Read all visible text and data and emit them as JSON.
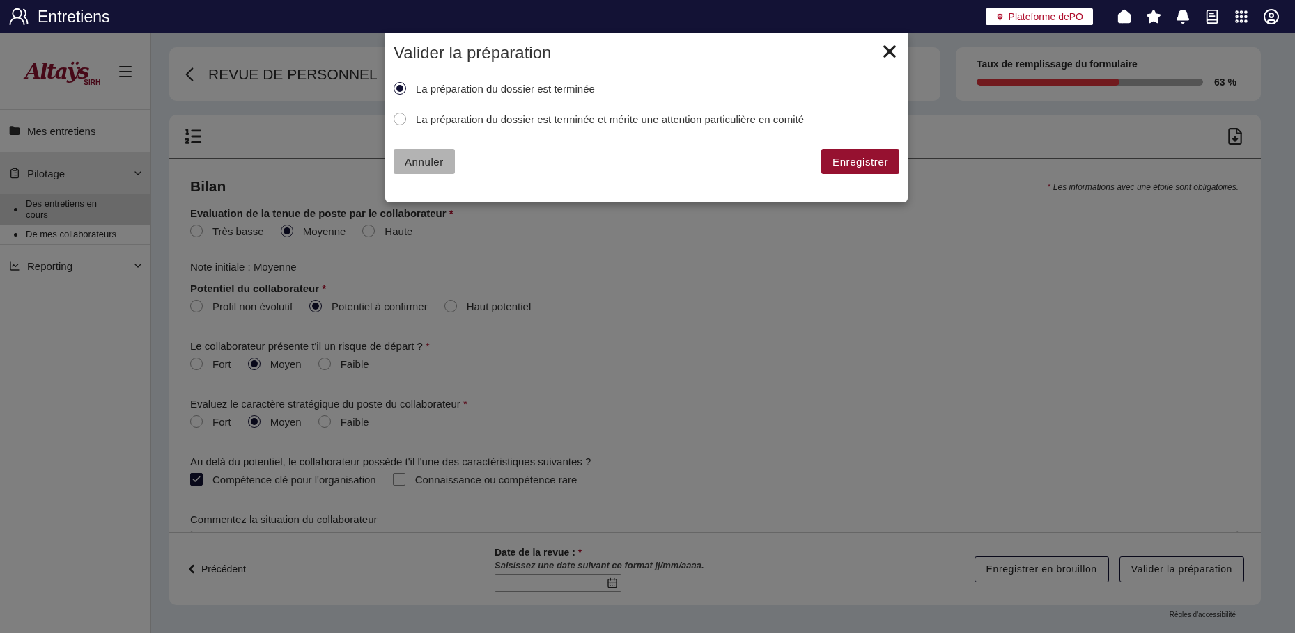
{
  "app": {
    "title": "Entretiens"
  },
  "topbar": {
    "platform": "Plateforme dePO"
  },
  "logo": {
    "name": "Altaÿs",
    "suffix": "SIRH"
  },
  "sidebar": {
    "items": [
      {
        "label": "Mes entretiens"
      },
      {
        "label": "Pilotage",
        "expanded": true,
        "children": [
          {
            "label": "Des entretiens en cours",
            "selected": true
          },
          {
            "label": "De mes collaborateurs",
            "selected": false
          }
        ]
      },
      {
        "label": "Reporting",
        "expanded": false
      }
    ]
  },
  "page": {
    "title": "REVUE DE PERSONNEL"
  },
  "progress": {
    "label": "Taux de remplissage du formulaire",
    "level": 0.63,
    "reading": "63 %"
  },
  "form": {
    "section": "Bilan",
    "legend": {
      "mark": "*",
      "text": "Les informations avec une étoile sont obligatoires."
    },
    "items": [
      {
        "kind": "radio",
        "label": "Evaluation de la tenue de poste par le collaborateur",
        "bold": true,
        "mark": "*",
        "options": [
          {
            "label": "Très basse",
            "selected": false
          },
          {
            "label": "Moyenne",
            "selected": true
          },
          {
            "label": "Haute",
            "selected": false
          }
        ]
      },
      {
        "kind": "note",
        "label": "Note initiale : Moyenne"
      },
      {
        "kind": "radio",
        "label": "Potentiel du collaborateur",
        "bold": true,
        "mark": "*",
        "options": [
          {
            "label": "Profil non évolutif",
            "selected": false
          },
          {
            "label": "Potentiel à confirmer",
            "selected": true
          },
          {
            "label": "Haut potentiel",
            "selected": false
          }
        ]
      },
      {
        "kind": "radio",
        "label": "Le collaborateur présente t'il un risque de départ ?",
        "bold": false,
        "mark": "*",
        "options": [
          {
            "label": "Fort",
            "selected": false
          },
          {
            "label": "Moyen",
            "selected": true
          },
          {
            "label": "Faible",
            "selected": false
          }
        ]
      },
      {
        "kind": "radio",
        "label": "Evaluez le caractère stratégique du poste du collaborateur",
        "bold": false,
        "mark": "*",
        "options": [
          {
            "label": "Fort",
            "selected": false
          },
          {
            "label": "Moyen",
            "selected": true
          },
          {
            "label": "Faible",
            "selected": false
          }
        ]
      },
      {
        "kind": "checkbox",
        "label": "Au delà du potentiel, le collaborateur possède t'il l'une des caractéristiques suivantes ?",
        "bold": false,
        "options": [
          {
            "label": "Compétence clé pour l'organisation",
            "checked": true
          },
          {
            "label": "Connaissance ou compétence rare",
            "checked": false
          }
        ]
      },
      {
        "kind": "textarea",
        "label": "Commentez la situation du collaborateur",
        "bold": false
      }
    ]
  },
  "footer": {
    "previous": "Précédent",
    "date_label": "Date de la revue :",
    "date_mark": "*",
    "date_hint": "Saisissez une date suivant ce format jj/mm/aaaa.",
    "buttons": [
      "Enregistrer en brouillon",
      "Valider la préparation"
    ]
  },
  "accessibility": "Règles d'accessibilité",
  "modal": {
    "title": "Valider la préparation",
    "options": [
      {
        "label": "La préparation du dossier est terminée",
        "selected": true
      },
      {
        "label": "La préparation du dossier est terminée et mérite une attention particulière en comité",
        "selected": false
      }
    ],
    "cancel": "Annuler",
    "save": "Enregistrer"
  }
}
